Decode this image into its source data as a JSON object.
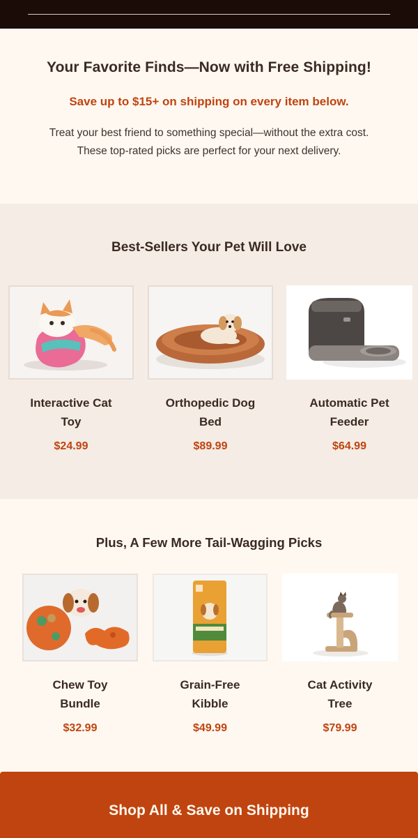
{
  "hero": {
    "title": "Your Favorite Finds—Now with Free Shipping!",
    "subtitle": "Save up to $15+ on shipping on every item below.",
    "body_line1": "Treat your best friend to something special—without the extra cost.",
    "body_line2": "These top-rated picks are perfect for your next delivery."
  },
  "best_sellers": {
    "heading": "Best-Sellers Your Pet Will Love",
    "items": [
      {
        "name_line1": "Interactive Cat",
        "name_line2": "Toy",
        "price": "$24.99",
        "image": "cat-toy-image"
      },
      {
        "name_line1": "Orthopedic Dog",
        "name_line2": "Bed",
        "price": "$89.99",
        "image": "dog-bed-image"
      },
      {
        "name_line1": "Automatic Pet",
        "name_line2": "Feeder",
        "price": "$64.99",
        "image": "pet-feeder-image"
      }
    ]
  },
  "more_picks": {
    "heading": "Plus, A Few More Tail-Wagging Picks",
    "items": [
      {
        "name_line1": "Chew Toy",
        "name_line2": "Bundle",
        "price": "$32.99",
        "image": "chew-toys-image"
      },
      {
        "name_line1": "Grain-Free",
        "name_line2": "Kibble",
        "price": "$49.99",
        "image": "kibble-bag-image"
      },
      {
        "name_line1": "Cat Activity",
        "name_line2": "Tree",
        "price": "$79.99",
        "image": "cat-tree-image"
      }
    ]
  },
  "cta": {
    "label": "Shop All & Save on Shipping"
  },
  "colors": {
    "accent": "#c0440f",
    "header_bg": "#1b0c07",
    "page_bg": "#fff8f1",
    "section_bg": "#f4ece5",
    "text": "#3a2a22"
  }
}
